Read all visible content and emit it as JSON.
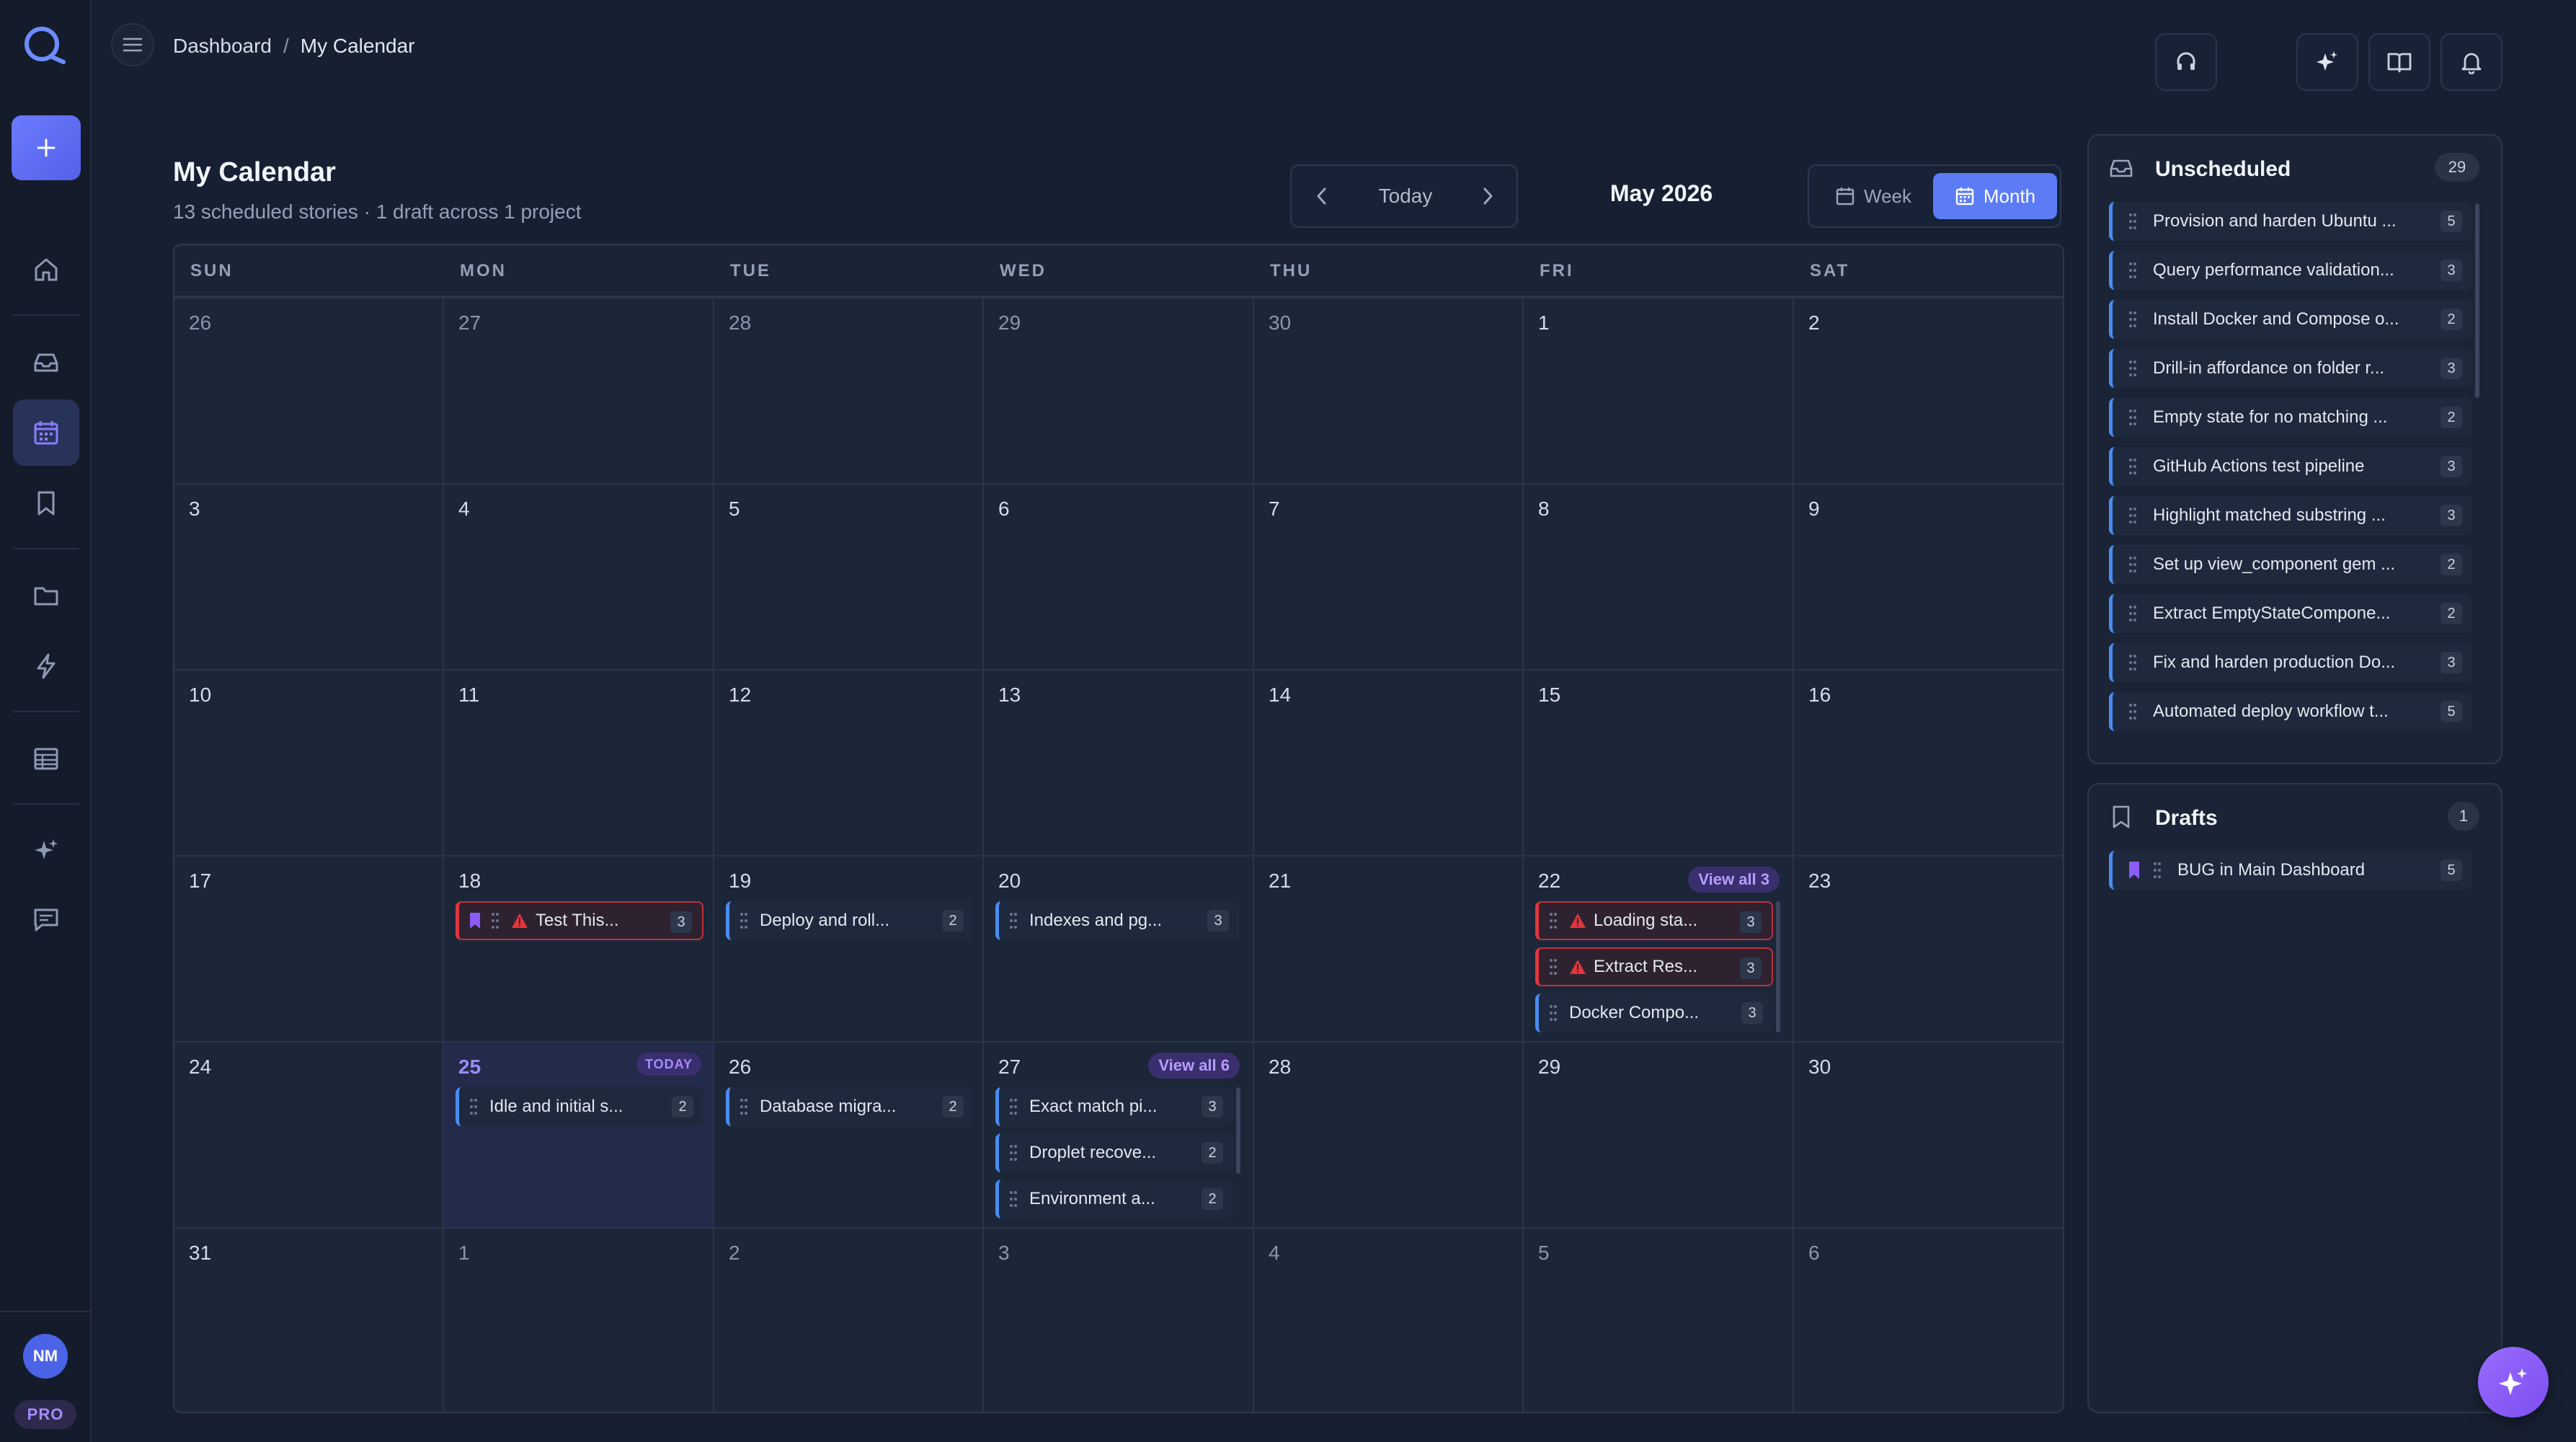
{
  "breadcrumb": {
    "root": "Dashboard",
    "separator": "/",
    "current": "My Calendar"
  },
  "page": {
    "title": "My Calendar",
    "subtitle": "13 scheduled stories · 1 draft across 1 project"
  },
  "nav": {
    "today_label": "Today",
    "month_label": "May 2026"
  },
  "view_toggle": {
    "week": "Week",
    "month": "Month",
    "selected": "Month"
  },
  "weekdays": [
    "SUN",
    "MON",
    "TUE",
    "WED",
    "THU",
    "FRI",
    "SAT"
  ],
  "weeks": [
    [
      "26",
      "27",
      "28",
      "29",
      "30",
      "1",
      "2"
    ],
    [
      "3",
      "4",
      "5",
      "6",
      "7",
      "8",
      "9"
    ],
    [
      "10",
      "11",
      "12",
      "13",
      "14",
      "15",
      "16"
    ],
    [
      "17",
      "18",
      "19",
      "20",
      "21",
      "22",
      "23"
    ],
    [
      "24",
      "25",
      "26",
      "27",
      "28",
      "29",
      "30"
    ],
    [
      "31",
      "1",
      "2",
      "3",
      "4",
      "5",
      "6"
    ]
  ],
  "today_badge": "TODAY",
  "events": {
    "mon18": {
      "title": "Test This...",
      "points": "3"
    },
    "tue19": {
      "title": "Deploy and roll...",
      "points": "2"
    },
    "wed20": {
      "title": "Indexes and pg...",
      "points": "3"
    },
    "fri22": {
      "view_all": "View all 3",
      "items": [
        {
          "title": "Loading sta...",
          "points": "3"
        },
        {
          "title": "Extract Res...",
          "points": "3"
        },
        {
          "title": "Docker Compo...",
          "points": "3"
        }
      ]
    },
    "mon25": {
      "title": "Idle and initial s...",
      "points": "2"
    },
    "tue26": {
      "title": "Database migra...",
      "points": "2"
    },
    "wed27": {
      "view_all": "View all 6",
      "items": [
        {
          "title": "Exact match pi...",
          "points": "3"
        },
        {
          "title": "Droplet recove...",
          "points": "2"
        },
        {
          "title": "Environment a...",
          "points": "2"
        }
      ]
    }
  },
  "unscheduled": {
    "title": "Unscheduled",
    "count": "29",
    "items": [
      {
        "title": "Provision and harden Ubuntu ...",
        "points": "5"
      },
      {
        "title": "Query performance validation...",
        "points": "3"
      },
      {
        "title": "Install Docker and Compose o...",
        "points": "2"
      },
      {
        "title": "Drill-in affordance on folder r...",
        "points": "3"
      },
      {
        "title": "Empty state for no matching ...",
        "points": "2"
      },
      {
        "title": "GitHub Actions test pipeline",
        "points": "3"
      },
      {
        "title": "Highlight matched substring ...",
        "points": "3"
      },
      {
        "title": "Set up view_component gem ...",
        "points": "2"
      },
      {
        "title": "Extract EmptyStateCompone...",
        "points": "2"
      },
      {
        "title": "Fix and harden production Do...",
        "points": "3"
      },
      {
        "title": "Automated deploy workflow t...",
        "points": "5"
      }
    ]
  },
  "drafts": {
    "title": "Drafts",
    "count": "1",
    "items": [
      {
        "title": "BUG in Main Dashboard",
        "points": "5"
      }
    ]
  },
  "user": {
    "initials": "NM",
    "plan": "PRO"
  },
  "colors": {
    "accent": "#5b7cf5",
    "purple": "#8b5cf6",
    "story_blue": "#4a8cf0",
    "bug_red": "#e0363f"
  }
}
